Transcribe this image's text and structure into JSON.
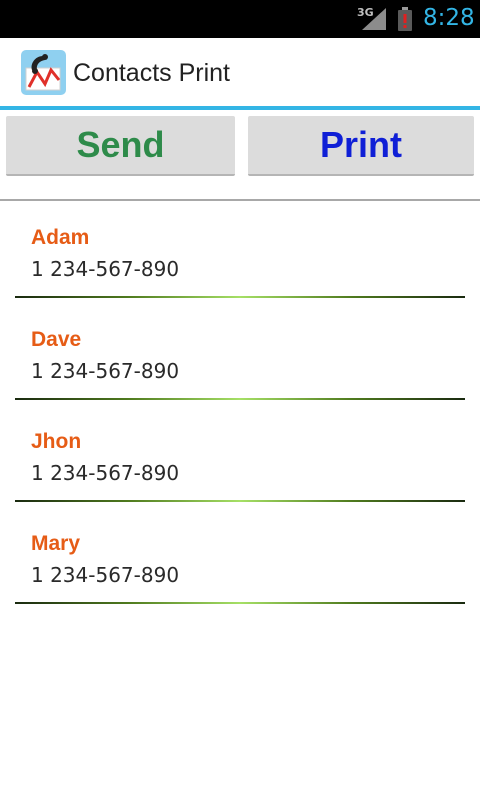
{
  "status_bar": {
    "network": "3G",
    "time": "8:28",
    "icons": [
      "signal-icon",
      "battery-alert-icon"
    ]
  },
  "action_bar": {
    "title": "Contacts Print",
    "icon": "app-logo-icon"
  },
  "buttons": {
    "send_label": "Send",
    "print_label": "Print"
  },
  "colors": {
    "accent": "#33b5e5",
    "send": "#2e8b4a",
    "print": "#0f1fd6",
    "contact_name": "#e65c16"
  },
  "contacts": [
    {
      "name": "Adam",
      "phone": "1 234-567-890"
    },
    {
      "name": "Dave",
      "phone": "1 234-567-890"
    },
    {
      "name": "Jhon",
      "phone": "1 234-567-890"
    },
    {
      "name": "Mary",
      "phone": "1 234-567-890"
    }
  ]
}
